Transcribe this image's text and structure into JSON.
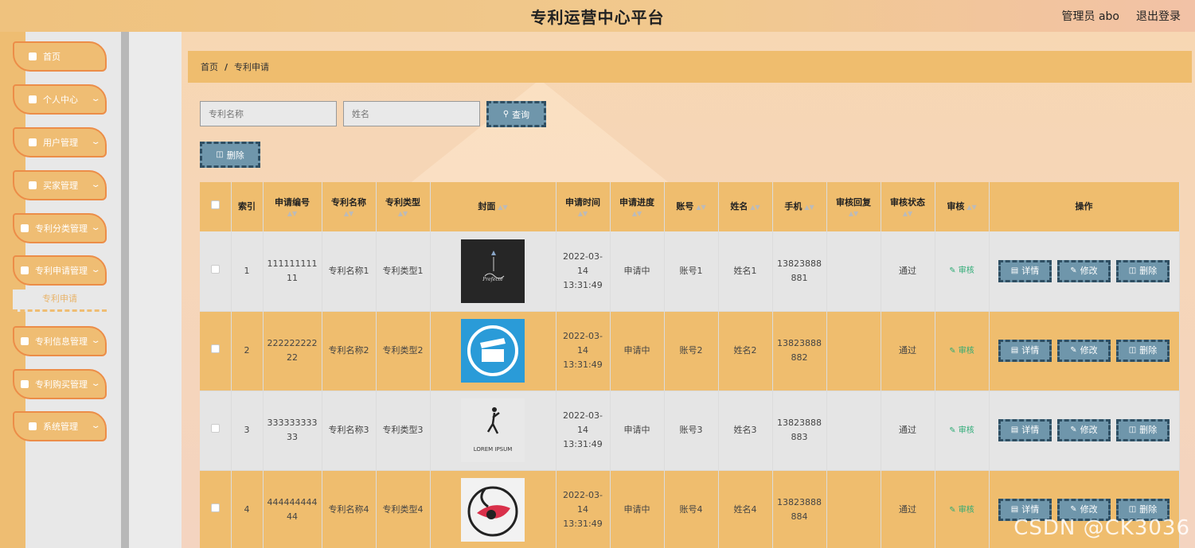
{
  "header": {
    "title": "专利运营中心平台",
    "admin": "管理员 abo",
    "logout": "退出登录"
  },
  "sidebar": {
    "items": [
      {
        "label": "首页",
        "icon": "home-icon"
      },
      {
        "label": "个人中心",
        "icon": "user-icon"
      },
      {
        "label": "用户管理",
        "icon": "grid-icon"
      },
      {
        "label": "买家管理",
        "icon": "flag-icon"
      },
      {
        "label": "专利分类管理",
        "icon": "chart-icon"
      },
      {
        "label": "专利申请管理",
        "icon": "clipboard-icon"
      },
      {
        "label": "专利信息管理",
        "icon": "sliders-icon"
      },
      {
        "label": "专利购买管理",
        "icon": "user-icon"
      },
      {
        "label": "系统管理",
        "icon": "grid-icon"
      }
    ],
    "sub_item": "专利申请"
  },
  "breadcrumb": {
    "home": "首页",
    "sep": "/",
    "current": "专利申请"
  },
  "search": {
    "name_placeholder": "专利名称",
    "person_placeholder": "姓名",
    "query_label": "查询",
    "delete_label": "删除"
  },
  "table": {
    "headers": [
      "索引",
      "申请编号",
      "专利名称",
      "专利类型",
      "封面",
      "申请时间",
      "申请进度",
      "账号",
      "姓名",
      "手机",
      "审核回复",
      "审核状态",
      "审核",
      "操作"
    ],
    "rows": [
      {
        "index": "1",
        "number": "11111111111",
        "name": "专利名称1",
        "type": "专利类型1",
        "cover": "ballet-logo",
        "time": "2022-03-14 13:31:49",
        "progress": "申请中",
        "account": "账号1",
        "person": "姓名1",
        "phone": "13823888881",
        "reply": "",
        "status": "通过",
        "audit": "审核"
      },
      {
        "index": "2",
        "number": "22222222222",
        "name": "专利名称2",
        "type": "专利类型2",
        "cover": "clapper-icon",
        "time": "2022-03-14 13:31:49",
        "progress": "申请中",
        "account": "账号2",
        "person": "姓名2",
        "phone": "13823888882",
        "reply": "",
        "status": "通过",
        "audit": "审核"
      },
      {
        "index": "3",
        "number": "33333333333",
        "name": "专利名称3",
        "type": "专利类型3",
        "cover": "dancer-logo",
        "time": "2022-03-14 13:31:49",
        "progress": "申请中",
        "account": "账号3",
        "person": "姓名3",
        "phone": "13823888883",
        "reply": "",
        "status": "通过",
        "audit": "审核"
      },
      {
        "index": "4",
        "number": "44444444444",
        "name": "专利名称4",
        "type": "专利类型4",
        "cover": "eye-logo",
        "time": "2022-03-14 13:31:49",
        "progress": "申请中",
        "account": "账号4",
        "person": "姓名4",
        "phone": "13823888884",
        "reply": "",
        "status": "通过",
        "audit": "审核"
      }
    ],
    "actions": {
      "detail": "详情",
      "edit": "修改",
      "delete": "删除"
    },
    "cover_text": {
      "lorem": "LOREM IPSUM"
    }
  },
  "watermark": "CSDN @CK3036",
  "colors": {
    "accent": "#efbd6e",
    "button": "#6f96ab",
    "button_border": "#2f4f63",
    "menu_border": "#ec8d48"
  }
}
